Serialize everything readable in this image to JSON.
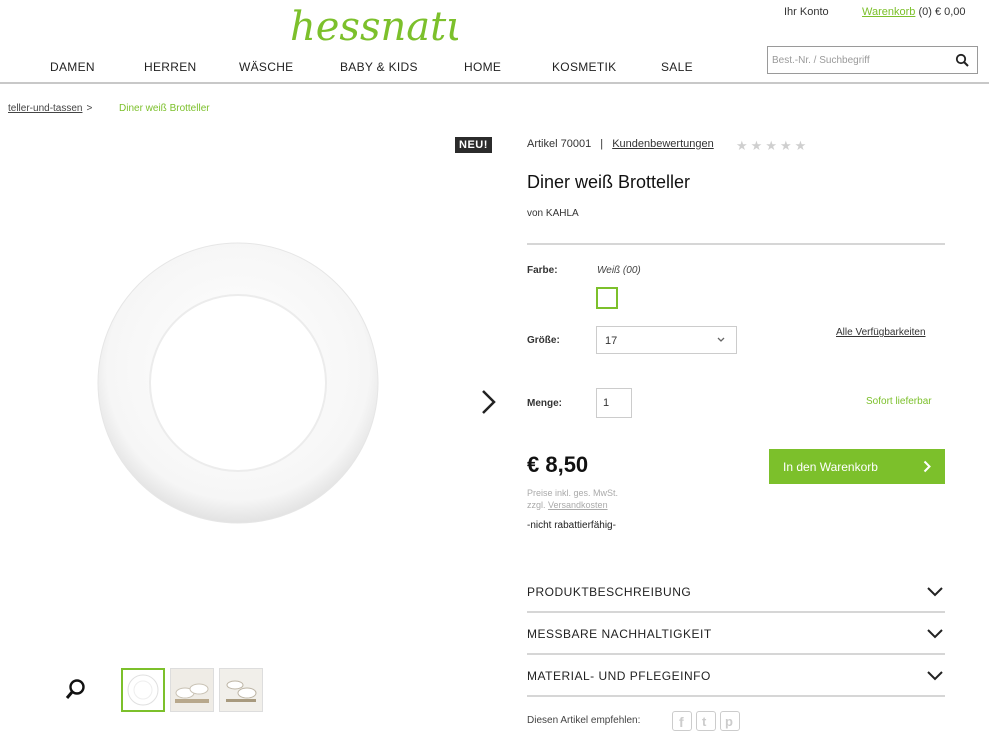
{
  "header": {
    "logo_text": "hessnatur",
    "account": "Ihr Konto",
    "cart_link": "Warenkorb",
    "cart_info": "(0) € 0,00",
    "search_placeholder": "Best.-Nr. / Suchbegriff"
  },
  "nav": [
    {
      "label": "DAMEN"
    },
    {
      "label": "HERREN"
    },
    {
      "label": "WÄSCHE"
    },
    {
      "label": "BABY & KIDS"
    },
    {
      "label": "HOME"
    },
    {
      "label": "KOSMETIK"
    },
    {
      "label": "SALE"
    }
  ],
  "breadcrumb": {
    "parent": "teller-und-tassen",
    "separator": ">",
    "current": "Diner weiß Brotteller"
  },
  "product": {
    "badge": "NEU!",
    "article": "Artikel 70001",
    "divider": "|",
    "reviews_link": "Kundenbewertungen",
    "rating_stars": 0,
    "rating_max": 5,
    "title": "Diner weiß Brotteller",
    "brand": "von KAHLA",
    "color_label": "Farbe:",
    "color_value": "Weiß (00)",
    "size_label": "Größe:",
    "size_value": "17",
    "availability_link": "Alle Verfügbarkeiten",
    "qty_label": "Menge:",
    "qty_value": "1",
    "stock_status": "Sofort lieferbar",
    "price": "€ 8,50",
    "cart_button": "In den Warenkorb",
    "price_note_1": "Preise inkl. ges. MwSt.",
    "price_note_2": "zzgl.",
    "shipping_link": "Versandkosten",
    "no_discount": "-nicht rabattierfähig-"
  },
  "accordion": [
    {
      "label": "PRODUKTBESCHREIBUNG"
    },
    {
      "label": "MESSBARE NACHHALTIGKEIT"
    },
    {
      "label": "MATERIAL- UND PFLEGEINFO"
    }
  ],
  "share_label": "Diesen Artikel empfehlen:",
  "colors": {
    "accent": "#7cc02b",
    "badge_bg": "#2b2b2b"
  }
}
